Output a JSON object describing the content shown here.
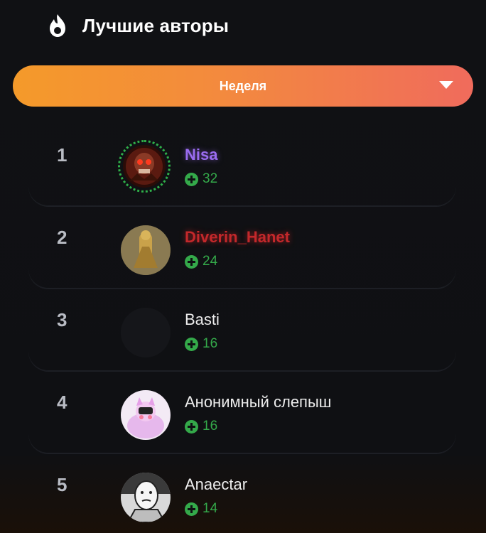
{
  "header": {
    "icon": "flame-icon",
    "title": "Лучшие авторы"
  },
  "period_select": {
    "selected": "Неделя",
    "icon": "chevron-down-icon"
  },
  "colors": {
    "accent_gradient_start": "#f49a2a",
    "accent_gradient_end": "#f06b5c",
    "score_green": "#34a94a",
    "name_purple": "#9a6cf0",
    "name_red": "#c3282b"
  },
  "authors": [
    {
      "rank": "1",
      "name": "Nisa",
      "score": "32",
      "avatar": "skull-avatar"
    },
    {
      "rank": "2",
      "name": "Diverin_Hanet",
      "score": "24",
      "avatar": "golden-figure-avatar"
    },
    {
      "rank": "3",
      "name": "Basti",
      "score": "16",
      "avatar": "empty-avatar"
    },
    {
      "rank": "4",
      "name": "Анонимный слепыш",
      "score": "16",
      "avatar": "pink-cat-avatar"
    },
    {
      "rank": "5",
      "name": "Anaectar",
      "score": "14",
      "avatar": "wojak-avatar"
    }
  ]
}
